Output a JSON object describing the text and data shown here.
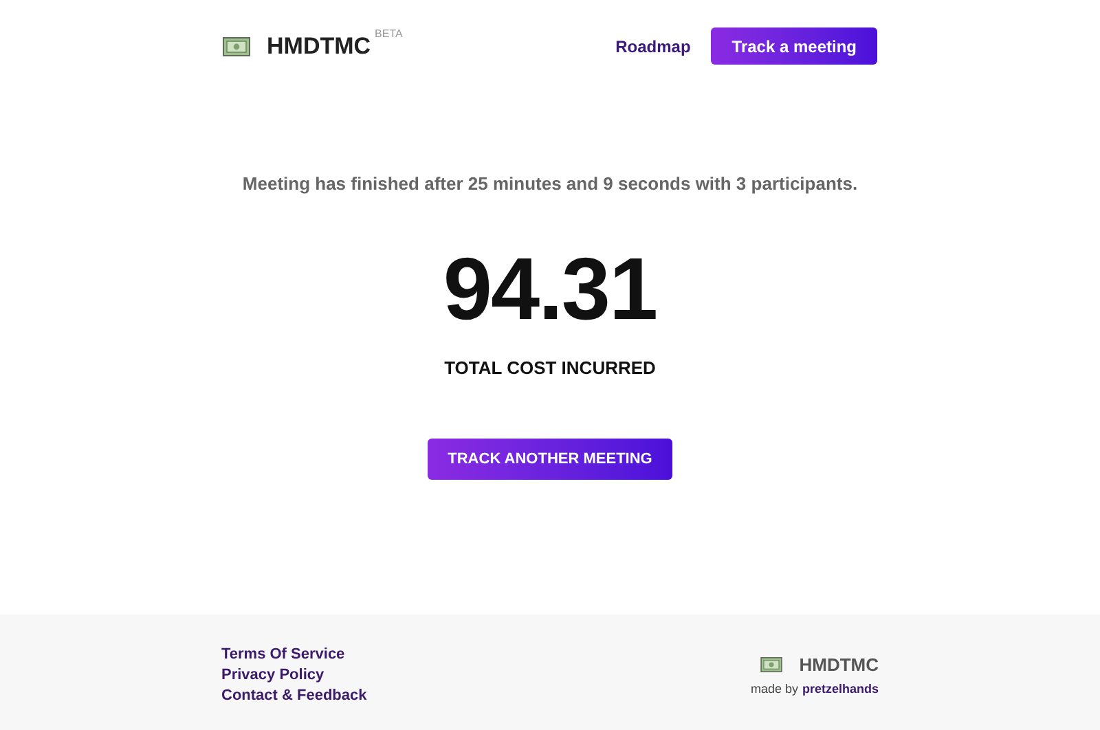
{
  "header": {
    "brand": "HMDTMC",
    "badge": "BETA",
    "nav_link": "Roadmap",
    "cta": "Track a meeting"
  },
  "summary": {
    "message": "Meeting has finished after 25 minutes and 9 seconds with 3 participants.",
    "cost": "94.31",
    "cost_label": "TOTAL COST INCURRED",
    "action": "TRACK ANOTHER MEETING"
  },
  "footer": {
    "links": [
      "Terms Of Service",
      "Privacy Policy",
      "Contact & Feedback"
    ],
    "brand": "HMDTMC",
    "credit": "made by",
    "author": "pretzelhands"
  }
}
